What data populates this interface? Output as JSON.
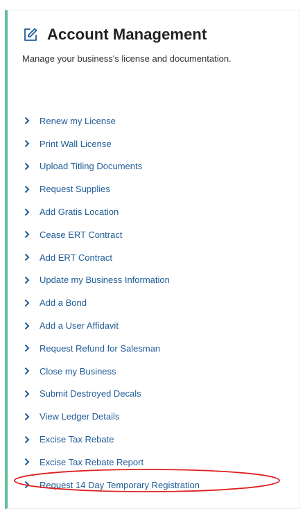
{
  "panel": {
    "title": "Account Management",
    "subtitle": "Manage your business's license and documentation.",
    "icon": "edit-icon",
    "accent_color": "#5fbf9a",
    "link_color": "#1f5b97",
    "highlight_color": "#e02020"
  },
  "links": [
    {
      "label": "Renew my License"
    },
    {
      "label": "Print Wall License"
    },
    {
      "label": "Upload Titling Documents"
    },
    {
      "label": "Request Supplies"
    },
    {
      "label": "Add Gratis Location"
    },
    {
      "label": "Cease ERT Contract"
    },
    {
      "label": "Add ERT Contract"
    },
    {
      "label": "Update my Business Information"
    },
    {
      "label": "Add a Bond"
    },
    {
      "label": "Add a User Affidavit"
    },
    {
      "label": "Request Refund for Salesman"
    },
    {
      "label": "Close my Business"
    },
    {
      "label": "Submit Destroyed Decals"
    },
    {
      "label": "View Ledger Details"
    },
    {
      "label": "Excise Tax Rebate"
    },
    {
      "label": "Excise Tax Rebate Report"
    },
    {
      "label": "Request 14 Day Temporary Registration"
    }
  ]
}
